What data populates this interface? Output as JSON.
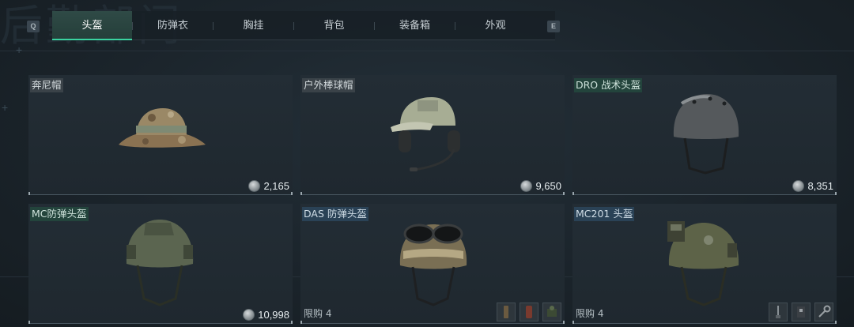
{
  "tabs": {
    "prev_key": "Q",
    "next_key": "E",
    "items": [
      {
        "label": "头盔",
        "active": true
      },
      {
        "label": "防弹衣",
        "active": false
      },
      {
        "label": "胸挂",
        "active": false
      },
      {
        "label": "背包",
        "active": false
      },
      {
        "label": "装备箱",
        "active": false
      },
      {
        "label": "外观",
        "active": false
      }
    ]
  },
  "items": [
    {
      "name": "奔尼帽",
      "price": "2,165",
      "name_style": "gray",
      "icon": "boonie-hat-icon"
    },
    {
      "name": "户外棒球帽",
      "price": "9,650",
      "name_style": "gray",
      "icon": "baseball-cap-headset-icon"
    },
    {
      "name": "DRO 战术头盔",
      "price": "8,351",
      "name_style": "green",
      "icon": "dro-helmet-icon"
    },
    {
      "name": "MC防弹头盔",
      "price": "10,998",
      "name_style": "green",
      "icon": "mc-helmet-icon"
    },
    {
      "name": "DAS 防弹头盔",
      "limit": "限购 4",
      "name_style": "blue",
      "icon": "das-helmet-icon",
      "mods": [
        "flashlight-mod-icon",
        "canister-mod-icon",
        "tactical-light-mod-icon"
      ]
    },
    {
      "name": "MC201 头盔",
      "limit": "限购 4",
      "name_style": "blue",
      "icon": "mc201-helmet-icon",
      "mods": [
        "antenna-mod-icon",
        "battery-mod-icon",
        "key-mod-icon"
      ]
    }
  ]
}
